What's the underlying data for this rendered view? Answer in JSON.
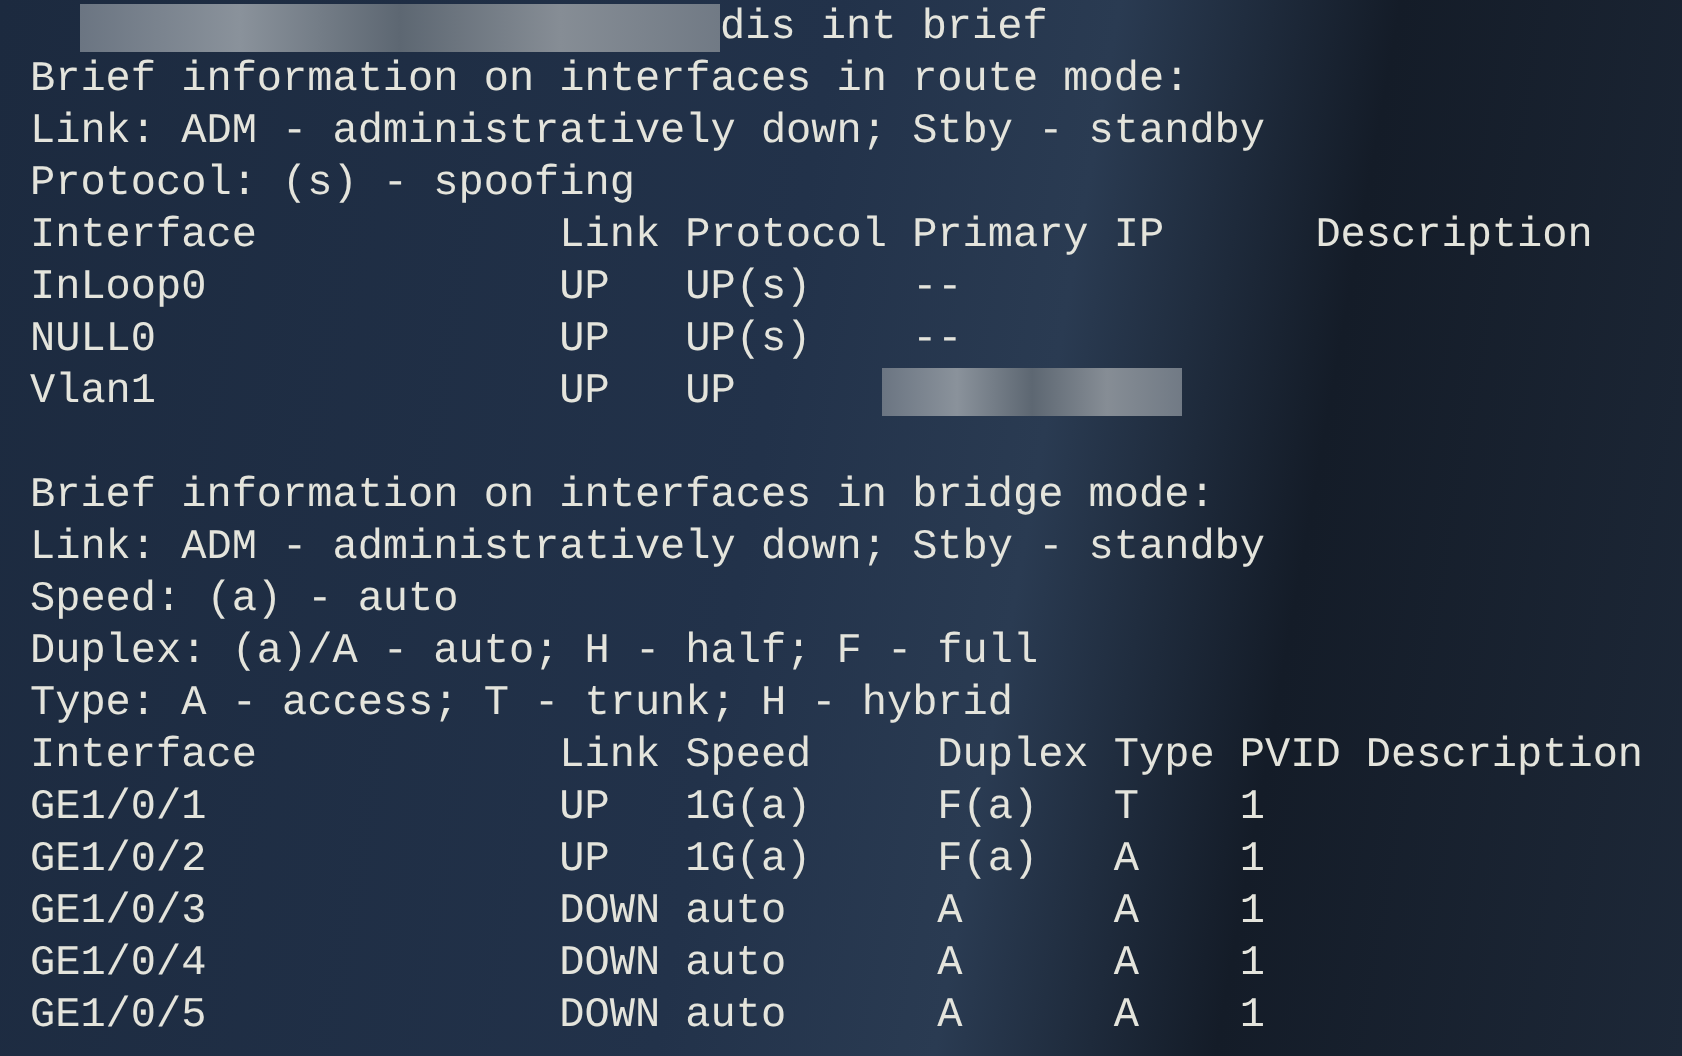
{
  "terminal": {
    "sections": [
      {
        "lines": [
          {
            "text": "dis int brief",
            "masked_prefix": true
          },
          {
            "text": "Brief information on interfaces in route mode:"
          },
          {
            "text": "Link: ADM - administratively down; Stby - standby"
          },
          {
            "text": "Protocol: (s) - spoofing"
          },
          {
            "text": "Interface            Link Protocol Primary IP      Description"
          },
          {
            "text": "InLoop0              UP   UP(s)    --"
          },
          {
            "text": "NULL0                UP   UP(s)    --"
          },
          {
            "text": "Vlan1                UP   UP",
            "masked_suffix": true
          }
        ]
      },
      {
        "lines": [
          {
            "text": "Brief information on interfaces in bridge mode:"
          },
          {
            "text": "Link: ADM - administratively down; Stby - standby"
          },
          {
            "text": "Speed: (a) - auto"
          },
          {
            "text": "Duplex: (a)/A - auto; H - half; F - full"
          },
          {
            "text": "Type: A - access; T - trunk; H - hybrid"
          },
          {
            "text": "Interface            Link Speed     Duplex Type PVID Description"
          },
          {
            "text": "GE1/0/1              UP   1G(a)     F(a)   T    1"
          },
          {
            "text": "GE1/0/2              UP   1G(a)     F(a)   A    1"
          },
          {
            "text": "GE1/0/3              DOWN auto      A      A    1"
          },
          {
            "text": "GE1/0/4              DOWN auto      A      A    1"
          },
          {
            "text": "GE1/0/5              DOWN auto      A      A    1"
          }
        ]
      }
    ]
  }
}
